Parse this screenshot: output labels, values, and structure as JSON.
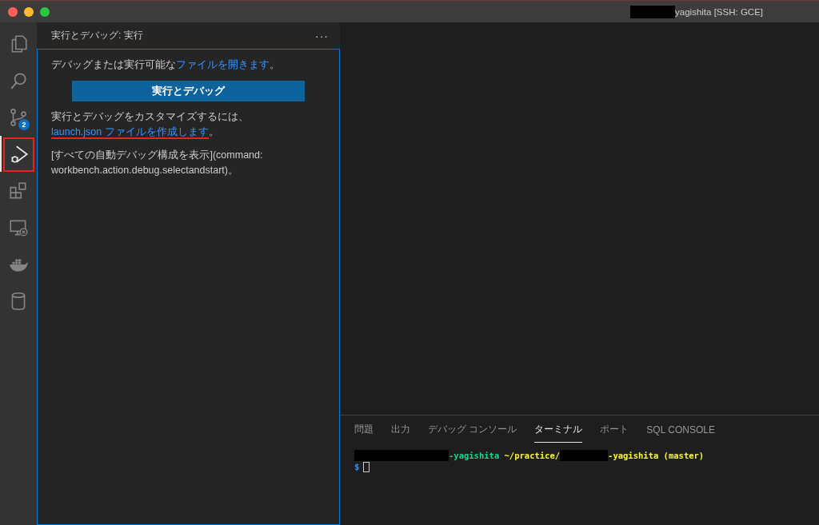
{
  "window": {
    "title_parts": [
      {
        "kind": "redacted"
      },
      {
        "kind": "text",
        "text": "yagishita [SSH: GCE]"
      }
    ]
  },
  "activity_bar": {
    "items": [
      {
        "kind": "files",
        "selected": false,
        "annotated": false
      },
      {
        "kind": "search",
        "selected": false,
        "annotated": false
      },
      {
        "kind": "source-control",
        "selected": false,
        "annotated": false,
        "badge": "2"
      },
      {
        "kind": "run-debug",
        "selected": true,
        "annotated": true
      },
      {
        "kind": "extensions",
        "selected": false,
        "annotated": false
      },
      {
        "kind": "remote",
        "selected": false,
        "annotated": false
      },
      {
        "kind": "docker",
        "selected": false,
        "annotated": false
      },
      {
        "kind": "database",
        "selected": false,
        "annotated": false
      }
    ]
  },
  "sidebar": {
    "title": "実行とデバッグ: 実行",
    "more": "···",
    "paragraphs": [
      {
        "segments": [
          {
            "kind": "text",
            "text": "デバッグまたは実行可能な"
          },
          {
            "kind": "link",
            "text": "ファイルを開きます",
            "annotated": false
          },
          {
            "kind": "text",
            "text": "。"
          }
        ]
      },
      {
        "kind": "button",
        "text": "実行とデバッグ"
      },
      {
        "segments": [
          {
            "kind": "text",
            "text": "実行とデバッグをカスタマイズするには、"
          },
          {
            "kind": "link",
            "text": "launch.json ファイルを作成します",
            "annotated": true
          },
          {
            "kind": "text",
            "text": "。"
          }
        ]
      },
      {
        "segments": [
          {
            "kind": "text",
            "text": "[すべての自動デバッグ構成を表示](command: workbench.action.debug.selectandstart)。"
          }
        ]
      }
    ]
  },
  "panel": {
    "tabs": [
      {
        "label": "問題",
        "selected": false
      },
      {
        "label": "出力",
        "selected": false
      },
      {
        "label": "デバッグ コンソール",
        "selected": false
      },
      {
        "label": "ターミナル",
        "selected": true
      },
      {
        "label": "ポート",
        "selected": false
      },
      {
        "label": "SQL CONSOLE",
        "selected": false
      }
    ],
    "terminal": {
      "lines": [
        {
          "segments": [
            {
              "kind": "redacted"
            },
            {
              "kind": "text",
              "text": "-yagishita",
              "color": "#23d18b"
            },
            {
              "kind": "text",
              "text": " ~/practice/",
              "color": "#f5f543"
            },
            {
              "kind": "redacted"
            },
            {
              "kind": "text",
              "text": "-yagishita (master)",
              "color": "#f5f543"
            }
          ]
        },
        {
          "segments": [
            {
              "kind": "text",
              "text": "$",
              "color": "#3b8eea"
            },
            {
              "kind": "cursor"
            }
          ]
        }
      ]
    }
  }
}
